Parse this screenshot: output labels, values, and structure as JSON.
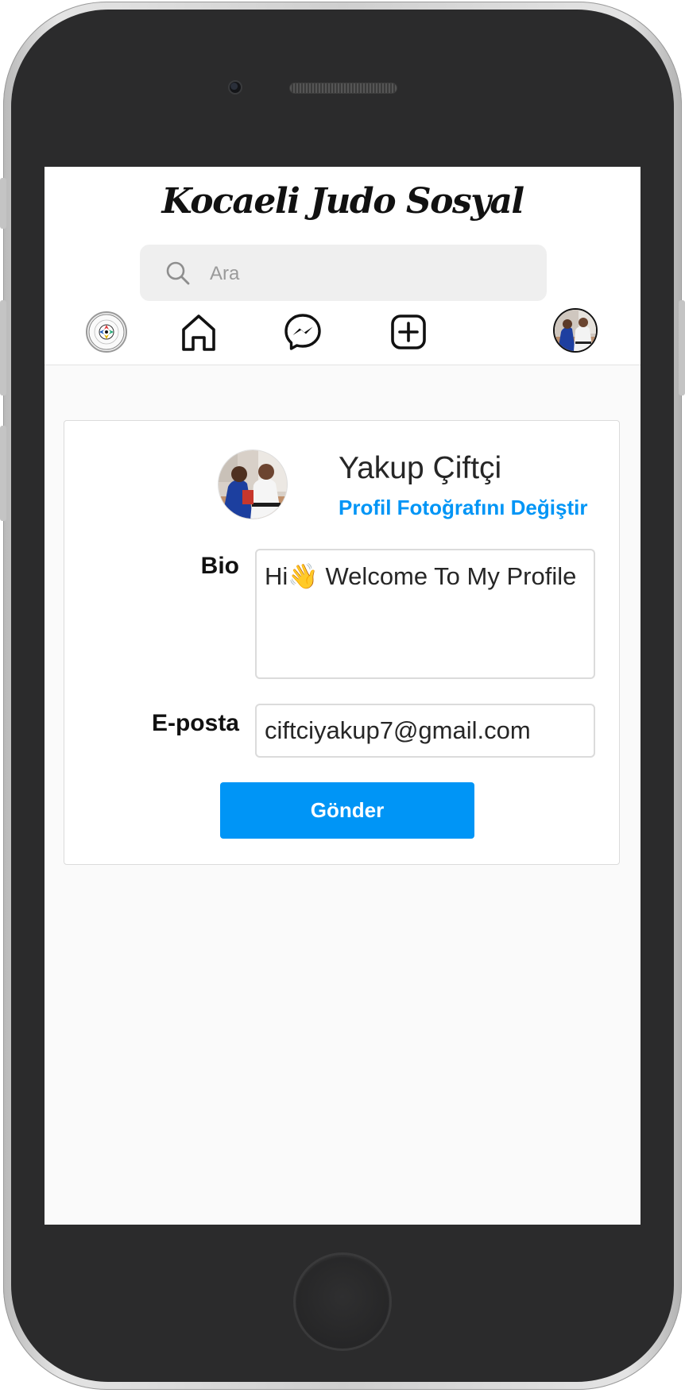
{
  "app": {
    "title": "Kocaeli Judo Sosyal"
  },
  "search": {
    "placeholder": "Ara",
    "value": ""
  },
  "nav": {
    "items": [
      {
        "name": "judo-federation-logo"
      },
      {
        "name": "home-icon"
      },
      {
        "name": "messenger-icon"
      },
      {
        "name": "add-post-icon"
      },
      {
        "name": "profile-avatar"
      }
    ]
  },
  "profile": {
    "name": "Yakup Çiftçi",
    "change_photo_label": "Profil Fotoğrafını Değiştir",
    "bio_label": "Bio",
    "bio_value": "Hi👋 Welcome To My Profile",
    "email_label": "E-posta",
    "email_value": "ciftciyakup7@gmail.com",
    "submit_label": "Gönder"
  },
  "colors": {
    "accent": "#0095f6",
    "frame": "#2b2b2c",
    "screen_bg": "#fafafa"
  }
}
